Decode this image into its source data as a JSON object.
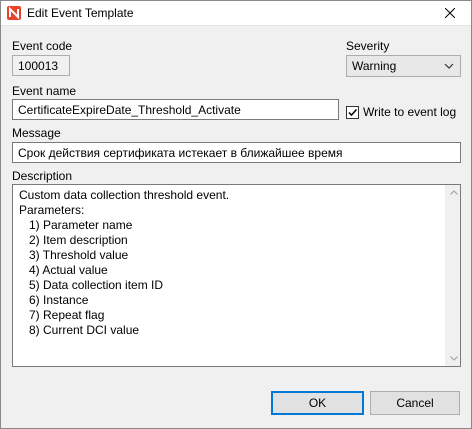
{
  "window": {
    "title": "Edit Event Template"
  },
  "event_code": {
    "label": "Event code",
    "value": "100013"
  },
  "severity": {
    "label": "Severity",
    "selected": "Warning"
  },
  "event_name": {
    "label": "Event name",
    "value": "CertificateExpireDate_Threshold_Activate"
  },
  "write_log": {
    "label": "Write to event log",
    "checked": true
  },
  "message": {
    "label": "Message",
    "value": "Срок действия сертификата истекает в ближайшее время"
  },
  "description": {
    "label": "Description",
    "lines": [
      "Custom data collection threshold event.",
      "Parameters:",
      "   1) Parameter name",
      "   2) Item description",
      "   3) Threshold value",
      "   4) Actual value",
      "   5) Data collection item ID",
      "   6) Instance",
      "   7) Repeat flag",
      "   8) Current DCI value"
    ]
  },
  "buttons": {
    "ok": "OK",
    "cancel": "Cancel"
  },
  "colors": {
    "accent": "#0078d7",
    "app_icon": "#e8442a"
  }
}
